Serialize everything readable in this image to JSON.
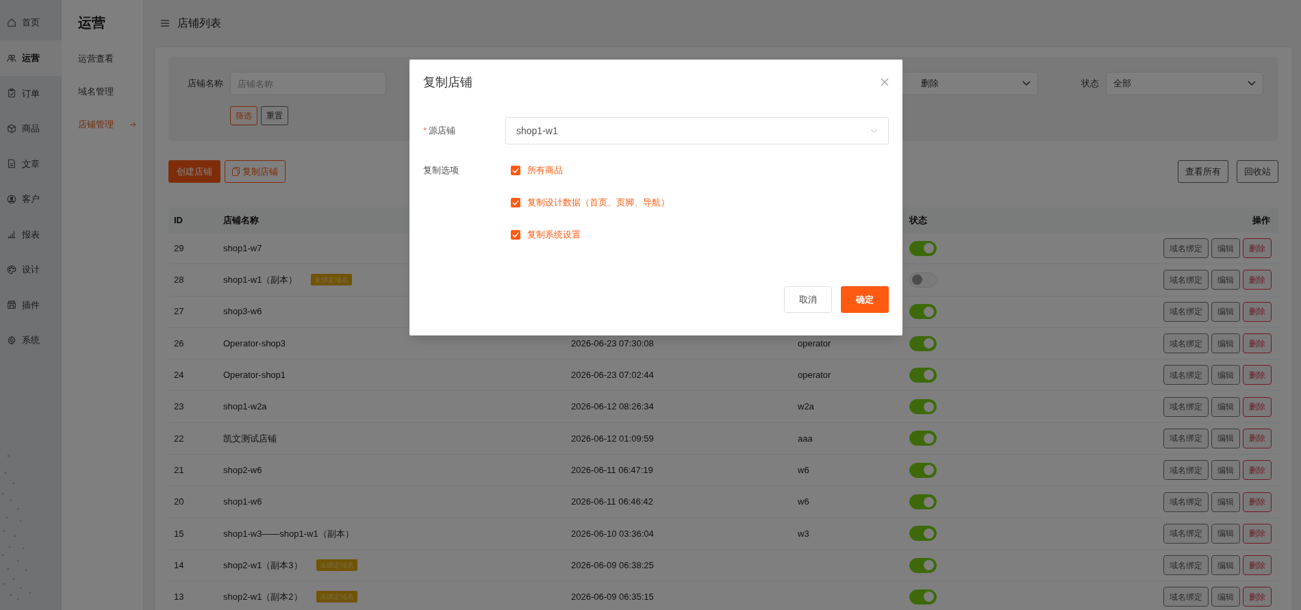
{
  "nav": [
    {
      "label": "首页",
      "selected": false
    },
    {
      "label": "运营",
      "selected": true
    },
    {
      "label": "订单",
      "selected": false
    },
    {
      "label": "商品",
      "selected": false
    },
    {
      "label": "文章",
      "selected": false
    },
    {
      "label": "客户",
      "selected": false
    },
    {
      "label": "报表",
      "selected": false
    },
    {
      "label": "设计",
      "selected": false
    },
    {
      "label": "插件",
      "selected": false
    },
    {
      "label": "系统",
      "selected": false
    }
  ],
  "submenu": {
    "title": "运营",
    "items": [
      {
        "label": "运营查看",
        "selected": false
      },
      {
        "label": "域名管理",
        "selected": false
      },
      {
        "label": "店铺管理",
        "selected": true
      }
    ]
  },
  "header": {
    "title": "店铺列表"
  },
  "filters": [
    {
      "kind": "input",
      "label": "店铺名称",
      "placeholder": "店铺名称"
    },
    {
      "kind": "select",
      "value": "删除"
    },
    {
      "kind": "select",
      "label": "状态",
      "value": "全部"
    }
  ],
  "filter_buttons": [
    {
      "kind": "primary",
      "label": "筛选"
    },
    {
      "kind": "default",
      "label": "重置"
    }
  ],
  "toolbar_left": [
    {
      "kind": "filled",
      "label": "创建店铺"
    },
    {
      "kind": "outline",
      "label": "复制店铺"
    }
  ],
  "toolbar_right": [
    {
      "label": "查看所有"
    },
    {
      "label": "回收站"
    }
  ],
  "table": {
    "columns": [
      "ID",
      "店铺名称",
      "状态",
      "操作"
    ],
    "rows": [
      {
        "id": "29",
        "name": "shop1-w7",
        "on": true,
        "actions": [
          "域名绑定",
          "编辑",
          "删除"
        ]
      },
      {
        "id": "28",
        "name": "shop1-w1（副本）",
        "tag": "未绑定域名",
        "on": false,
        "actions": [
          "域名绑定",
          "编辑",
          "删除"
        ]
      },
      {
        "id": "27",
        "name": "shop3-w6",
        "on": true,
        "actions": [
          "域名绑定",
          "编辑",
          "删除"
        ]
      },
      {
        "id": "26",
        "name": "Operator-shop3",
        "created": "2026-06-23 07:30:08",
        "column_4": "operator",
        "on": true,
        "actions": [
          "域名绑定",
          "编辑",
          "删除"
        ]
      },
      {
        "id": "24",
        "name": "Operator-shop1",
        "created": "2026-06-23 07:02:44",
        "column_4": "operator",
        "on": true,
        "actions": [
          "域名绑定",
          "编辑",
          "删除"
        ]
      },
      {
        "id": "23",
        "name": "shop1-w2a",
        "created": "2026-06-12 08:26:34",
        "column_4": "w2a",
        "on": true,
        "actions": [
          "域名绑定",
          "编辑",
          "删除"
        ]
      },
      {
        "id": "22",
        "name": "凯文测试店铺",
        "created": "2026-06-12 01:09:59",
        "column_4": "aaa",
        "on": true,
        "actions": [
          "域名绑定",
          "编辑",
          "删除"
        ]
      },
      {
        "id": "21",
        "name": "shop2-w6",
        "created": "2026-06-11 06:47:19",
        "column_4": "w6",
        "on": true,
        "actions": [
          "域名绑定",
          "编辑",
          "删除"
        ]
      },
      {
        "id": "20",
        "name": "shop1-w6",
        "created": "2026-06-11 06:46:42",
        "column_4": "w6",
        "on": true,
        "actions": [
          "域名绑定",
          "编辑",
          "删除"
        ]
      },
      {
        "id": "15",
        "name": "shop1-w3——shop1-w1（副本）",
        "created": "2026-06-10 03:36:04",
        "column_4": "w3",
        "on": true,
        "actions": [
          "域名绑定",
          "编辑",
          "删除"
        ]
      },
      {
        "id": "14",
        "name": "shop2-w1（副本3）",
        "tag": "未绑定域名",
        "created": "2026-06-09 06:38:25",
        "on": true,
        "actions": [
          "域名绑定",
          "编辑",
          "删除"
        ]
      },
      {
        "id": "13",
        "name": "shop2-w1（副本2）",
        "tag": "未绑定域名",
        "created": "2026-06-09 06:35:15",
        "on": true,
        "actions": [
          "域名绑定",
          "编辑",
          "删除"
        ]
      }
    ]
  },
  "modal": {
    "title": "复制店铺",
    "source_label": "源店铺",
    "required_mark": "*",
    "source_value": "shop1-w1",
    "options_label": "复制选项",
    "options": [
      {
        "label": "所有商品",
        "checked": true
      },
      {
        "label": "复制设计数据（首页、页脚、导航）",
        "checked": true
      },
      {
        "label": "复制系统设置",
        "checked": true
      }
    ],
    "buttons": [
      {
        "kind": "default",
        "label": "取消"
      },
      {
        "kind": "primary",
        "label": "确定"
      }
    ]
  }
}
